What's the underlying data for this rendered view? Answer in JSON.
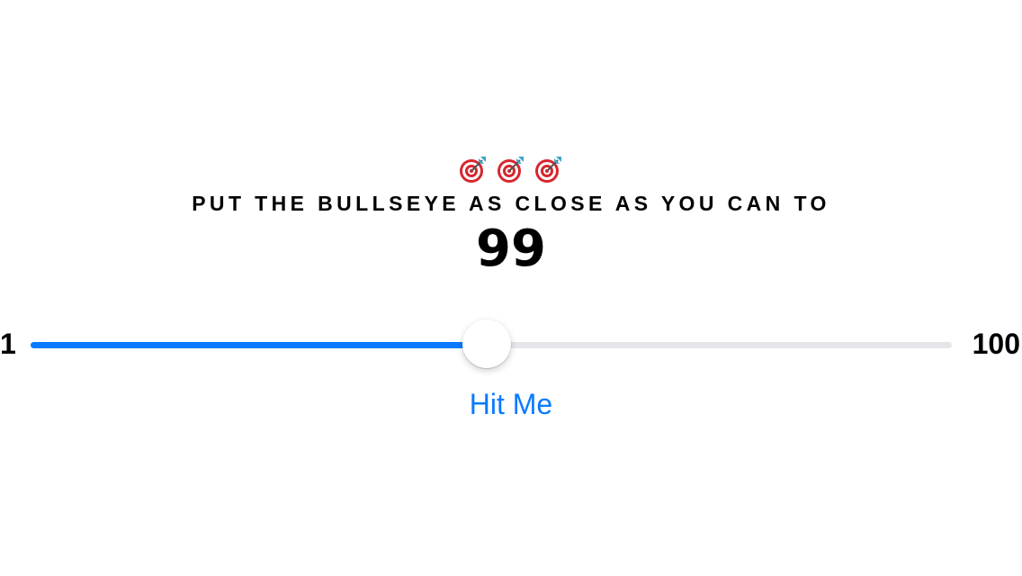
{
  "header": {
    "icons": [
      "dart-target-icon",
      "dart-target-icon",
      "dart-target-icon"
    ],
    "instruction": "PUT THE BULLSEYE AS CLOSE AS YOU CAN TO",
    "target_value": "99"
  },
  "slider": {
    "min_label": "1",
    "max_label": "100",
    "min": 1,
    "max": 100,
    "value": 50
  },
  "actions": {
    "hit_label": "Hit Me"
  },
  "colors": {
    "accent": "#0a7aff",
    "track": "#e5e5ea",
    "text": "#000000"
  }
}
